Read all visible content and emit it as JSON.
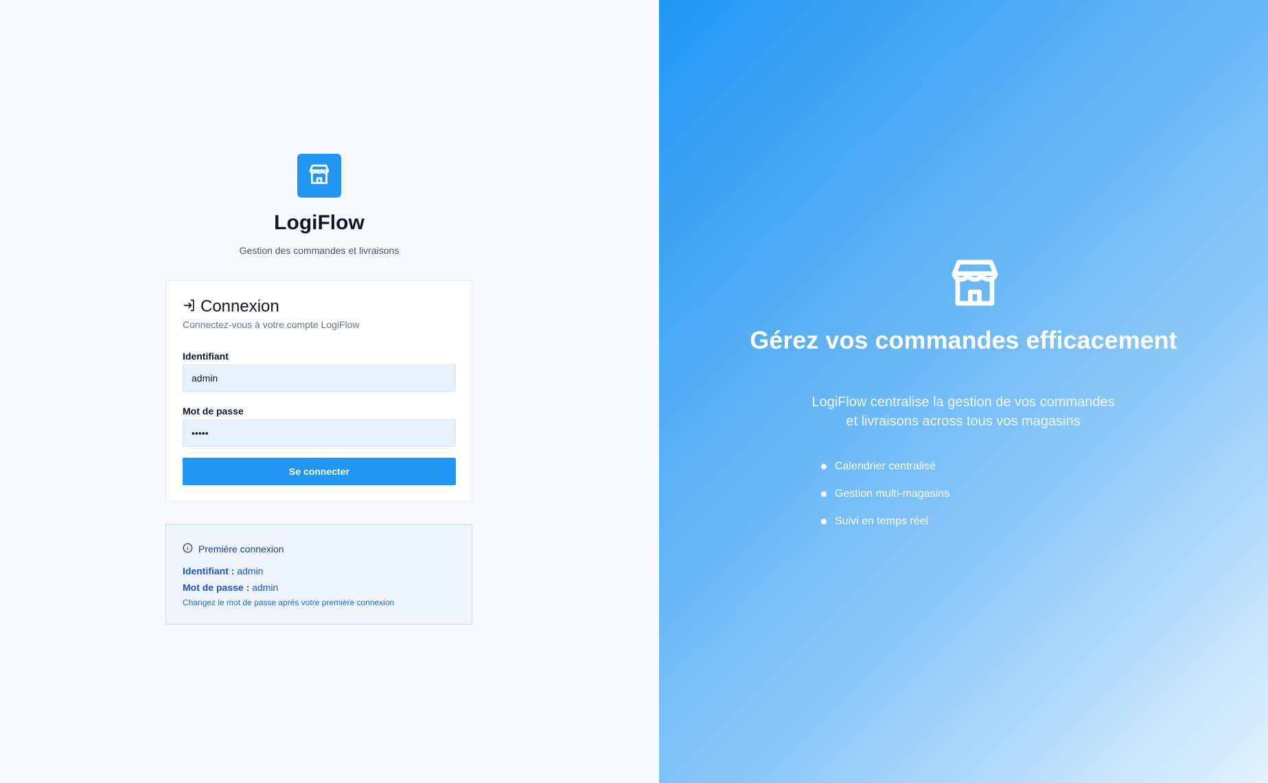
{
  "brand": {
    "name": "LogiFlow",
    "tagline": "Gestion des commandes et livraisons",
    "accent_color": "#2196f3",
    "logo_icon": "store-icon"
  },
  "login": {
    "title_icon": "login-arrow-icon",
    "title": "Connexion",
    "description": "Connectez-vous à votre compte LogiFlow",
    "username_label": "Identifiant",
    "username_value": "admin",
    "password_label": "Mot de passe",
    "password_value": "admin",
    "submit_label": "Se connecter"
  },
  "first_login": {
    "icon": "info-icon",
    "title": "Première connexion",
    "username_label": "Identifiant :",
    "username_value": "admin",
    "password_label": "Mot de passe :",
    "password_value": "admin",
    "note": "Changez le mot de passe après votre première connexion"
  },
  "hero": {
    "icon": "store-icon",
    "title": "Gérez vos commandes efficacement",
    "description": "LogiFlow centralise la gestion de vos commandes et livraisons across tous vos magasins",
    "features": [
      "Calendrier centralisé",
      "Gestion multi-magasins",
      "Suivi en temps réel"
    ]
  }
}
